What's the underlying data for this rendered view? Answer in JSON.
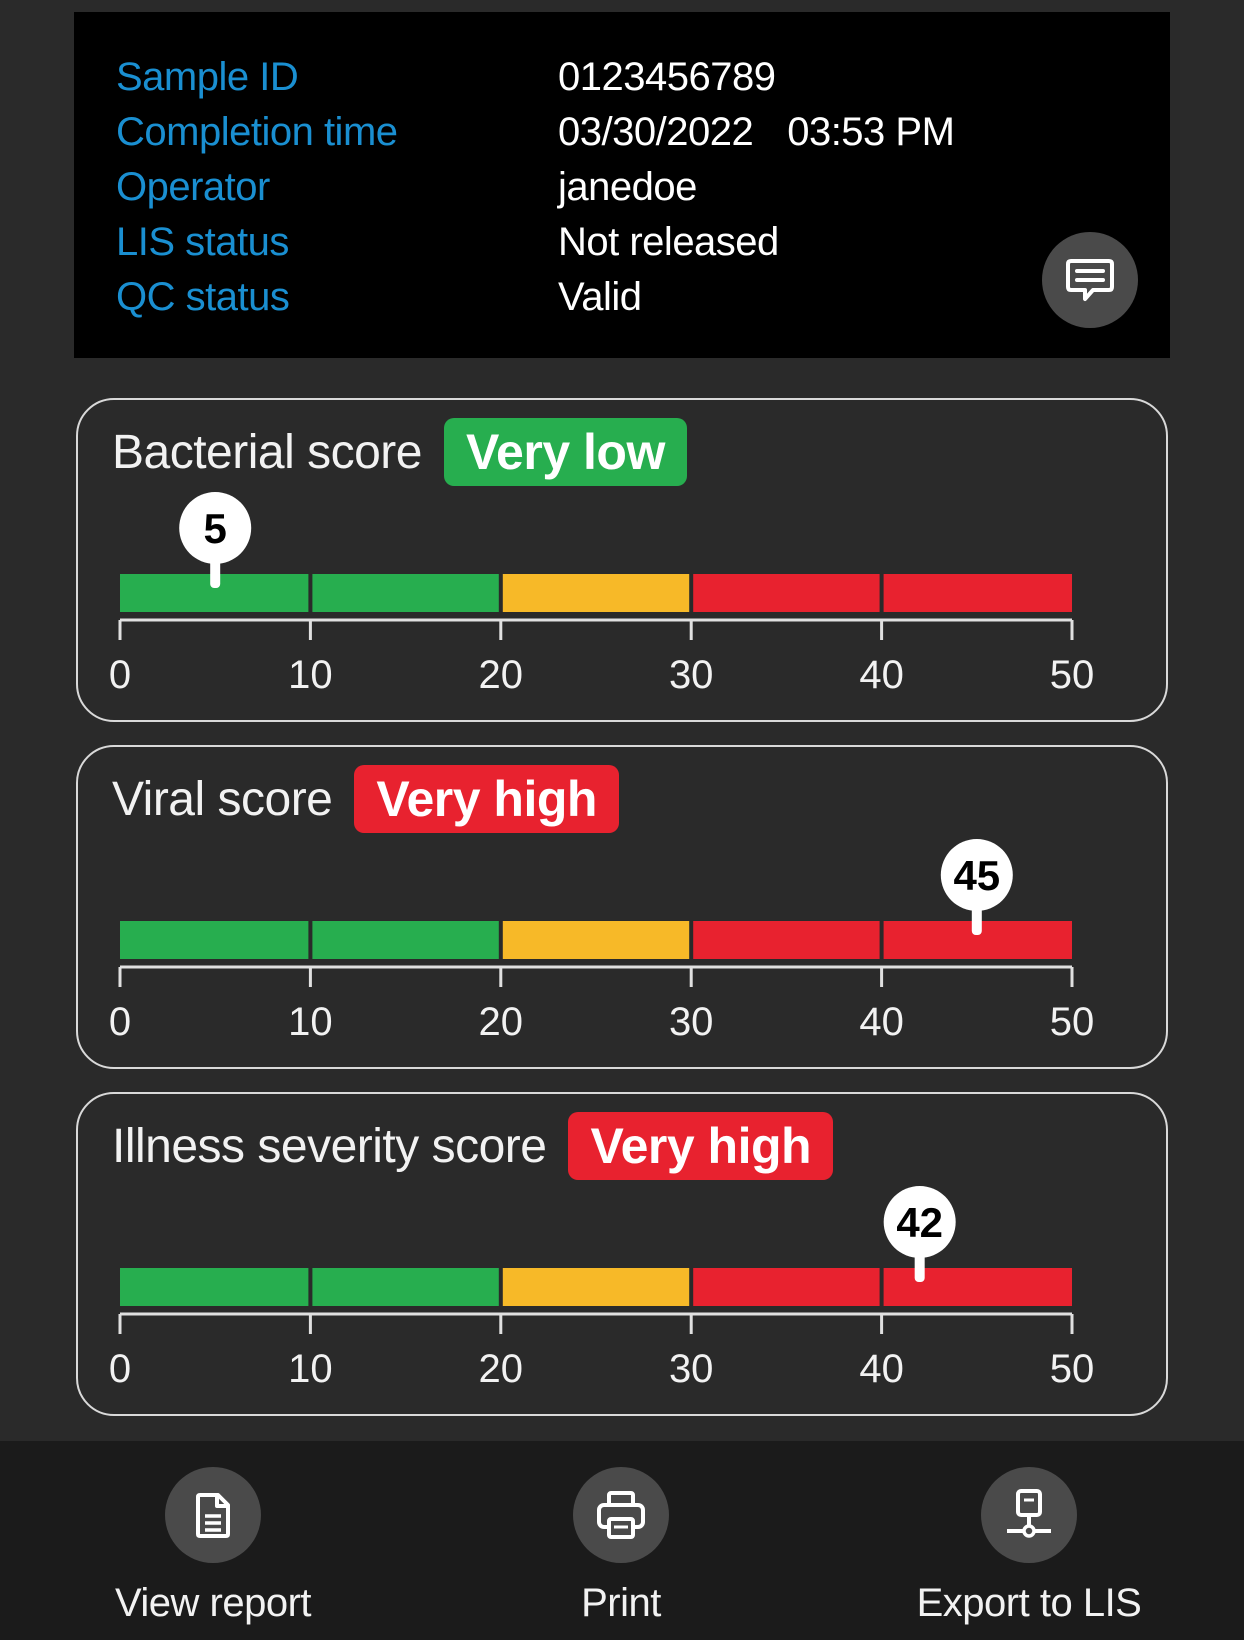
{
  "sample_info": {
    "rows": [
      {
        "label": "Sample ID",
        "value": "0123456789"
      },
      {
        "label": "Completion time",
        "value": "03/30/2022",
        "value2": "03:53 PM"
      },
      {
        "label": "Operator",
        "value": "janedoe"
      },
      {
        "label": "LIS status",
        "value": "Not released"
      },
      {
        "label": "QC status",
        "value": "Valid"
      }
    ],
    "comment_icon": "comment-icon"
  },
  "colors": {
    "label_blue": "#1a8fd1",
    "green": "#27ae4f",
    "yellow": "#f7b928",
    "red": "#e8222f",
    "panel_black": "#000000",
    "background": "#2a2a2a"
  },
  "scale": {
    "min": 0,
    "max": 50,
    "tick_labels": [
      "0",
      "10",
      "20",
      "30",
      "40",
      "50"
    ],
    "segment_colors": [
      "#27ae4f",
      "#27ae4f",
      "#f7b928",
      "#e8222f",
      "#e8222f"
    ]
  },
  "scores": [
    {
      "title": "Bacterial score",
      "badge": "Very low",
      "badge_color": "#27ae4f",
      "value": 5,
      "value_label": "5"
    },
    {
      "title": "Viral score",
      "badge": "Very high",
      "badge_color": "#e8222f",
      "value": 45,
      "value_label": "45"
    },
    {
      "title": "Illness severity score",
      "badge": "Very high",
      "badge_color": "#e8222f",
      "value": 42,
      "value_label": "42"
    }
  ],
  "actions": [
    {
      "label": "View report",
      "icon": "document-icon"
    },
    {
      "label": "Print",
      "icon": "printer-icon"
    },
    {
      "label": "Export to LIS",
      "icon": "network-export-icon"
    }
  ]
}
